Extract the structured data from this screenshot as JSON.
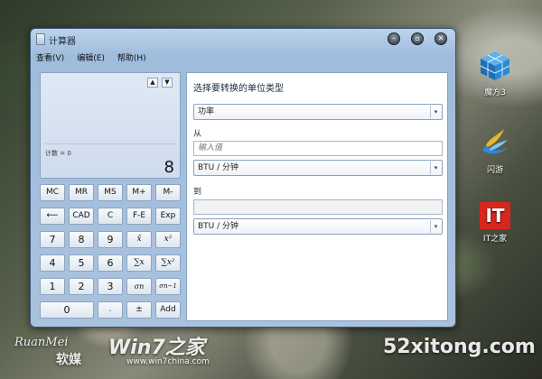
{
  "window": {
    "title": "计算器",
    "menu": [
      "查看(V)",
      "编辑(E)",
      "帮助(H)"
    ]
  },
  "display": {
    "scroll_up": "▲",
    "scroll_down": "▼",
    "count_label": "计数 = 0",
    "value": "8"
  },
  "keys": {
    "mc": "MC",
    "mr": "MR",
    "ms": "MS",
    "mplus": "M+",
    "mminus": "M-",
    "back": "⟵",
    "cad": "CAD",
    "c": "C",
    "fe": "F-E",
    "exp": "Exp",
    "n7": "7",
    "n8": "8",
    "n9": "9",
    "xbar": "x̄",
    "x2": "x²",
    "n4": "4",
    "n5": "5",
    "n6": "6",
    "sumx": "∑x",
    "sumx2": "∑x²",
    "n1": "1",
    "n2": "2",
    "n3": "3",
    "sigman": "σn",
    "sigman1": "σn−1",
    "n0": "0",
    "dot": ".",
    "plusminus": "±",
    "add": "Add"
  },
  "converter": {
    "heading": "选择要转换的单位类型",
    "unit_type": "功率",
    "from_label": "从",
    "from_placeholder": "输入值",
    "from_unit": "BTU / 分钟",
    "to_label": "到",
    "to_value": "",
    "to_unit": "BTU / 分钟"
  },
  "desktop": {
    "icons": [
      "魔方3",
      "闪游",
      "IT之家"
    ],
    "it_logo_text": "IT"
  },
  "watermarks": {
    "ruanmei": "RuanMei",
    "ruanmei_cn": "软媒",
    "win7": "Win7之家",
    "win7_url": "www.win7china.com",
    "site": "52xitong.com"
  },
  "colors": {
    "window_chrome": "#a9c2de",
    "display_bg": "#dfe9f5",
    "it_logo_red": "#d9261c"
  }
}
